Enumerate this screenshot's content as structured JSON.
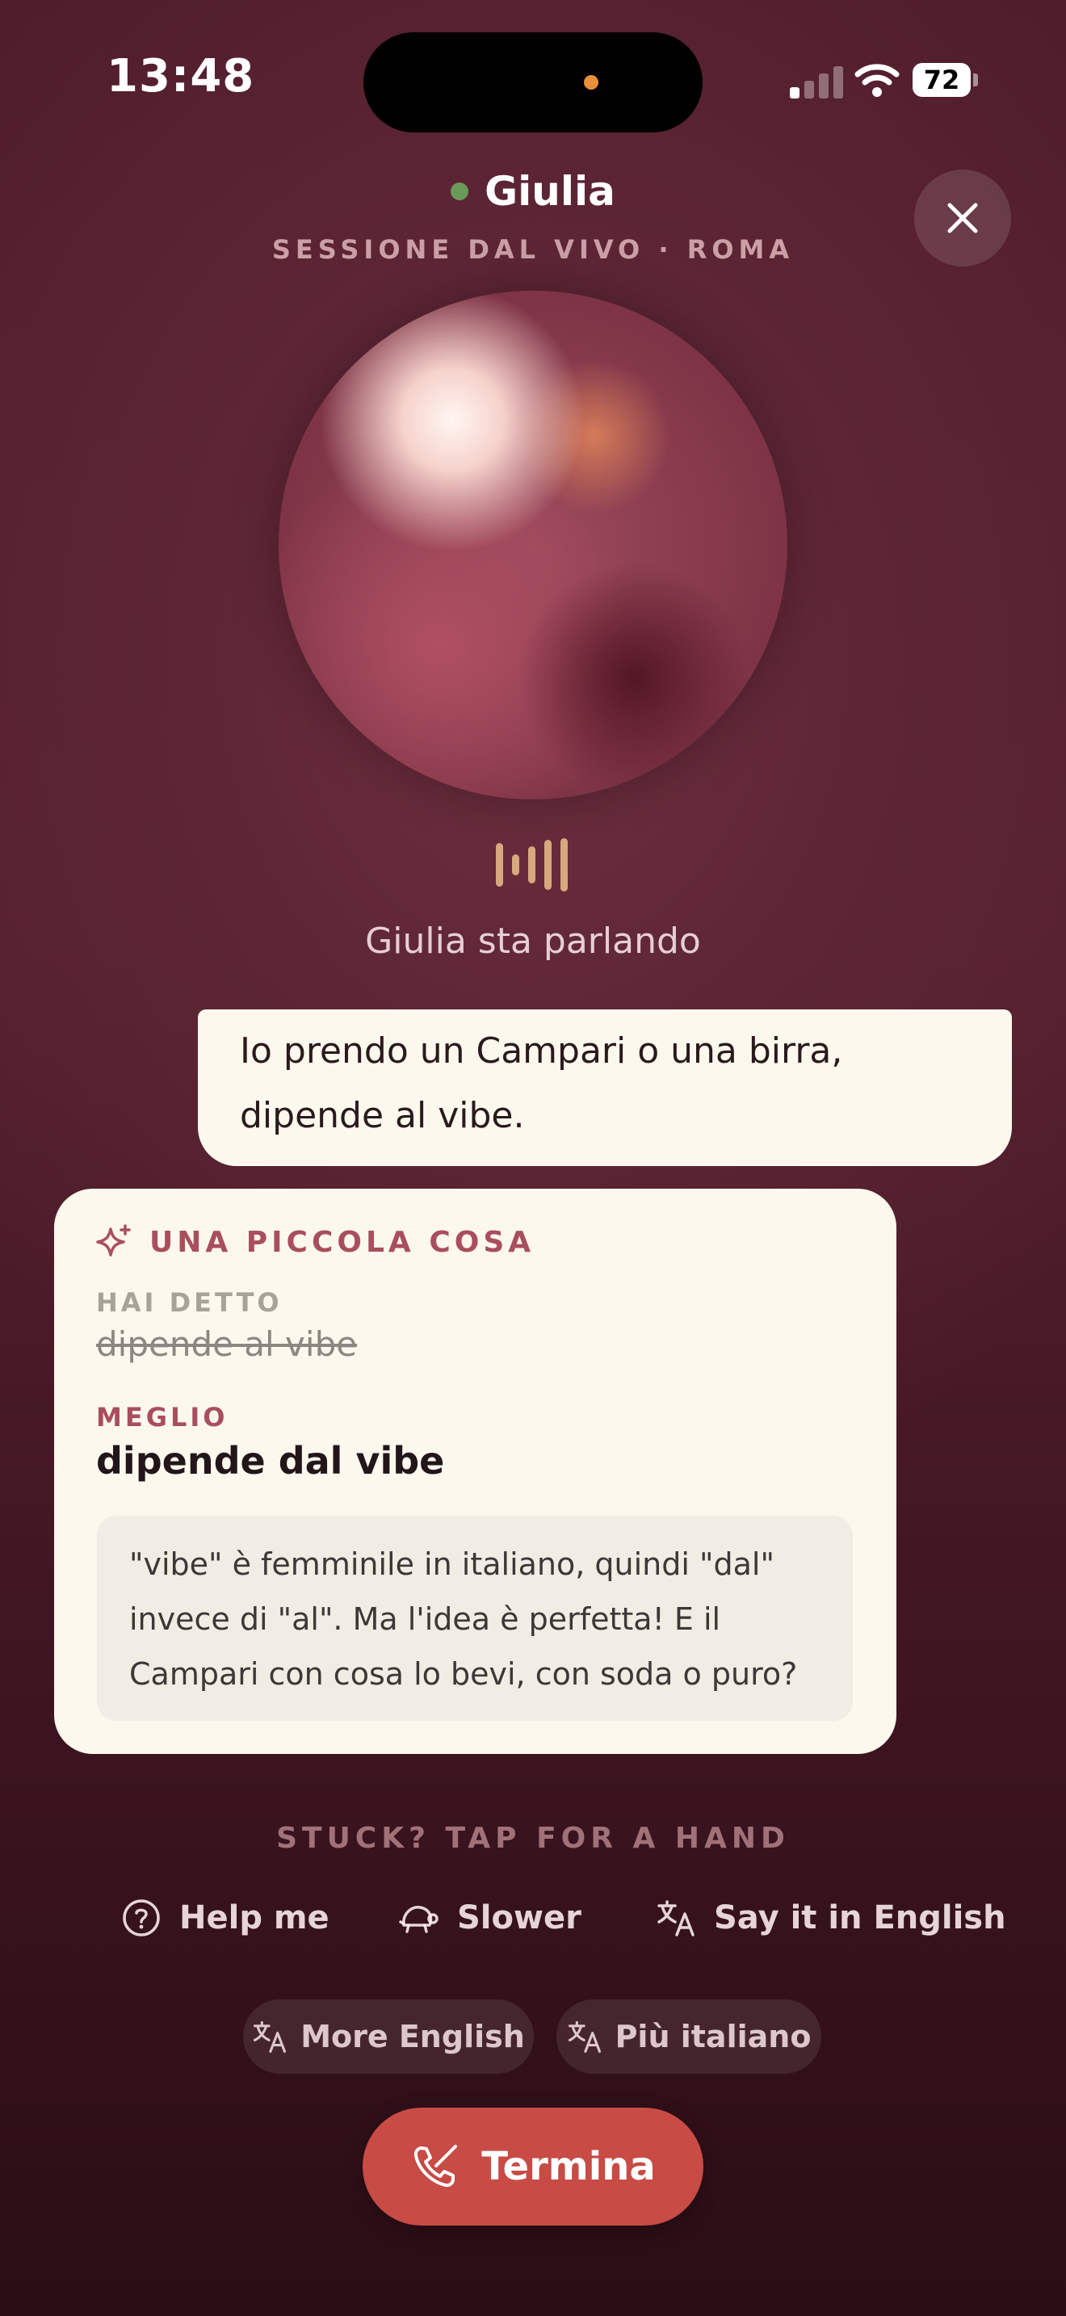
{
  "status_bar": {
    "time": "13:48",
    "battery": "72"
  },
  "header": {
    "name": "Giulia",
    "subtitle": "SESSIONE DAL VIVO · ROMA"
  },
  "speaking_status": "Giulia sta parlando",
  "message": {
    "text": "Io prendo un Campari o una birra, dipende al vibe."
  },
  "correction": {
    "title": "UNA PICCOLA COSA",
    "said_label": "HAI DETTO",
    "said_text": "dipende al vibe",
    "better_label": "MEGLIO",
    "better_text": "dipende dal vibe",
    "note": "\"vibe\" è femminile in italiano, quindi \"dal\" invece di \"al\". Ma l'idea è perfetta! E il Campari con cosa lo bevi, con soda o puro?"
  },
  "help": {
    "prompt": "STUCK? TAP FOR A HAND",
    "actions": [
      "Help me",
      "Slower",
      "Say it in English"
    ],
    "pills": [
      "More English",
      "Più italiano"
    ]
  },
  "end_button": "Termina",
  "colors": {
    "accent": "#c84b45",
    "card": "#fcf8ee",
    "title_accent": "#a94e5d",
    "online": "#6a9a5a"
  },
  "icons": [
    "close-icon",
    "sparkle-icon",
    "help-circle-icon",
    "turtle-icon",
    "translate-icon",
    "phone-off-icon",
    "audio-wave-icon"
  ]
}
